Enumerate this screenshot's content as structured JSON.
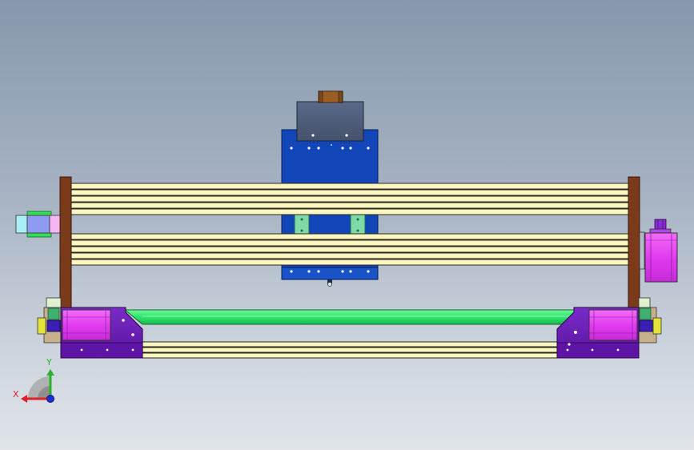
{
  "triad": {
    "x_label": "X",
    "y_label": "Y"
  },
  "colors": {
    "background_top": "#8797ad",
    "background_bottom": "#e1e5ea",
    "z_carriage_blue": "#1246b8",
    "spindle_motor_gray": "#4c5b78",
    "spindle_cap_brown": "#7a4a1a",
    "rail_yellow": "#fbf6c2",
    "gantry_post_brown": "#7b3a1a",
    "end_plate_purple": "#6b1fb5",
    "bearing_block_magenta": "#e040f0",
    "bottom_plate_green": "#3ef07a",
    "axis_x_red": "#e0202a",
    "axis_y_green": "#27b327",
    "axis_z_blue": "#1b2fd8"
  }
}
